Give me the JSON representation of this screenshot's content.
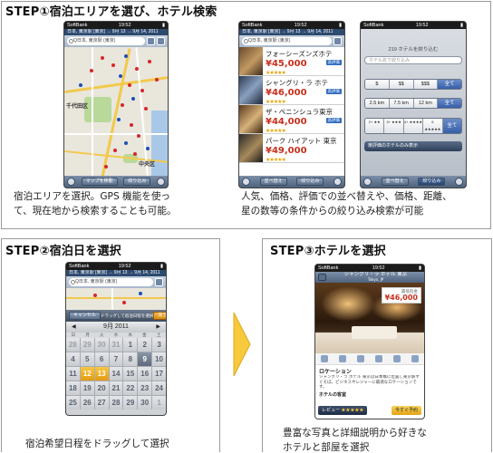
{
  "step1": {
    "title": "STEP①宿泊エリアを選び、ホテル検索",
    "caption_left_line1": "宿泊エリアを選択。GPS 機能を使っ",
    "caption_left_line2": "て、現在地から検索することも可能。",
    "caption_right_line1": "人気、価格、評価での並べ替えや、価格、距離、",
    "caption_right_line2": "星の数等の条件からの絞り込み検索が可能"
  },
  "step2": {
    "title": "STEP②宿泊日を選択",
    "caption": "宿泊希望日程をドラッグして選択"
  },
  "step3": {
    "title": "STEP③ホテルを選択",
    "caption_line1": "豊富な写真と詳細説明から好きな",
    "caption_line2": "ホテルと部屋を選択"
  },
  "phone_common": {
    "carrier": "SoftBank",
    "time": "19:52",
    "sub": "日本, 東京駅 [東京] → 9月 13 → 9月 14, 2011",
    "search_value": "Q日本, 東京駅 (東京)"
  },
  "map_phone": {
    "label_chiyoda": "千代田区",
    "label_chuo": "中央区",
    "btn_map": "マップを移動",
    "btn_sort": "絞り込み"
  },
  "list_phone": {
    "hotels": [
      {
        "name": "フォーシーズンズホテ",
        "price": "¥45,000",
        "badge": "高評価"
      },
      {
        "name": "シャングリ・ラ ホテ",
        "price": "¥46,000",
        "badge": "高評価"
      },
      {
        "name": "ザ・ペニンシュラ東京",
        "price": "¥44,000",
        "badge": "高評価"
      },
      {
        "name": "パーク ハイアット 東京",
        "price": "¥49,000",
        "badge": ""
      }
    ],
    "btn_sort": "並べ替え",
    "btn_filter": "絞り込み"
  },
  "filter_phone": {
    "header": "219 ホテルを絞り込む",
    "field_placeholder": "ホテル名で絞り込み",
    "price": [
      "$",
      "$$",
      "$$$",
      "全て"
    ],
    "distance": [
      "2.5 km",
      "7.5 km",
      "12 km",
      "全て"
    ],
    "stars": [
      "2+ ★★",
      "3+ ★★★",
      "4+ ★★★★",
      "5 ★★★★★",
      "全て"
    ],
    "deal_button": "楽評価のホテルのみ表示",
    "btn_sort": "並べ替え",
    "btn_filter": "絞り込み"
  },
  "cal_phone": {
    "cancel": "キャンセル",
    "hint": "ドラッグして宿泊日程を選択",
    "done": "完了",
    "month": "9月 2011",
    "dow": [
      "日",
      "月",
      "火",
      "水",
      "木",
      "金",
      "土"
    ],
    "weeks": [
      [
        "28",
        "29",
        "30",
        "31",
        "1",
        "2",
        "3"
      ],
      [
        "4",
        "5",
        "6",
        "7",
        "8",
        "9",
        "10"
      ],
      [
        "11",
        "12",
        "13",
        "14",
        "15",
        "16",
        "17"
      ],
      [
        "18",
        "19",
        "20",
        "21",
        "22",
        "23",
        "24"
      ],
      [
        "25",
        "26",
        "27",
        "28",
        "29",
        "30",
        "1"
      ]
    ]
  },
  "detail_phone": {
    "hotel_name": "シャングリ・ラ ホテル 東京",
    "hotel_sub": "Tokyo, JP",
    "price_label": "最低料金",
    "price": "¥46,000",
    "section_location": "ロケーション",
    "location_text": "シャングリ・ラ ホテル 東京は日本橋に位置し東京駅すぐそば。ビジネスやレジャーに最適なロケーションです。",
    "rooms_label": "ホテルの客室",
    "review_label": "レビュー",
    "reserve": "今すぐ予約"
  },
  "colors": {
    "border": "#9a9a9a",
    "arrow": "#f7c93d",
    "accent_price": "#c7301e"
  }
}
